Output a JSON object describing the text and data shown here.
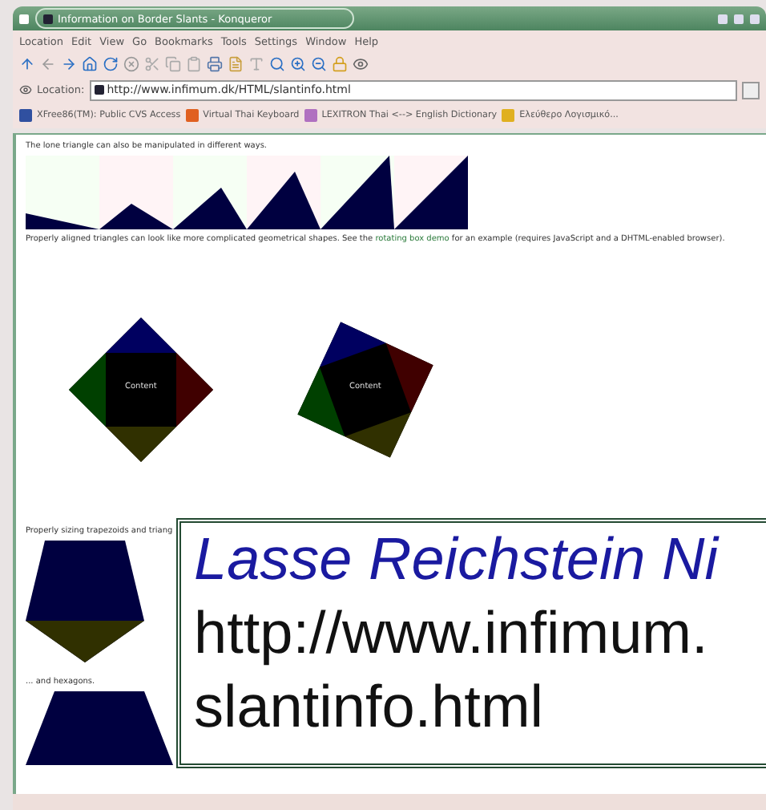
{
  "window": {
    "title": "Information on Border Slants - Konqueror"
  },
  "menu": [
    "Location",
    "Edit",
    "View",
    "Go",
    "Bookmarks",
    "Tools",
    "Settings",
    "Window",
    "Help"
  ],
  "location": {
    "label": "Location:",
    "url": "http://www.infimum.dk/HTML/slantinfo.html"
  },
  "bookmarks": [
    {
      "label": "XFree86(TM): Public CVS Access"
    },
    {
      "label": "Virtual Thai Keyboard"
    },
    {
      "label": "LEXITRON Thai <--> English Dictionary"
    },
    {
      "label": "Ελεύθερο Λογισμικό..."
    }
  ],
  "page": {
    "intro": "The lone triangle can also be manipulated in different ways.",
    "aligned": {
      "before": "Properly aligned triangles can look like more complicated geometrical shapes. See the ",
      "link": "rotating box demo",
      "after": " for an example (requires JavaScript and a DHTML-enabled browser)."
    },
    "boxes": [
      {
        "label": "Content"
      },
      {
        "label": "Content"
      }
    ],
    "sizing": "Properly sizing trapezoids and triang",
    "hexagons": "... and hexagons."
  },
  "caption": {
    "author": "Lasse Reichstein Ni",
    "url_line_1": "http://www.infimum.",
    "url_line_2": "slantinfo.html"
  }
}
